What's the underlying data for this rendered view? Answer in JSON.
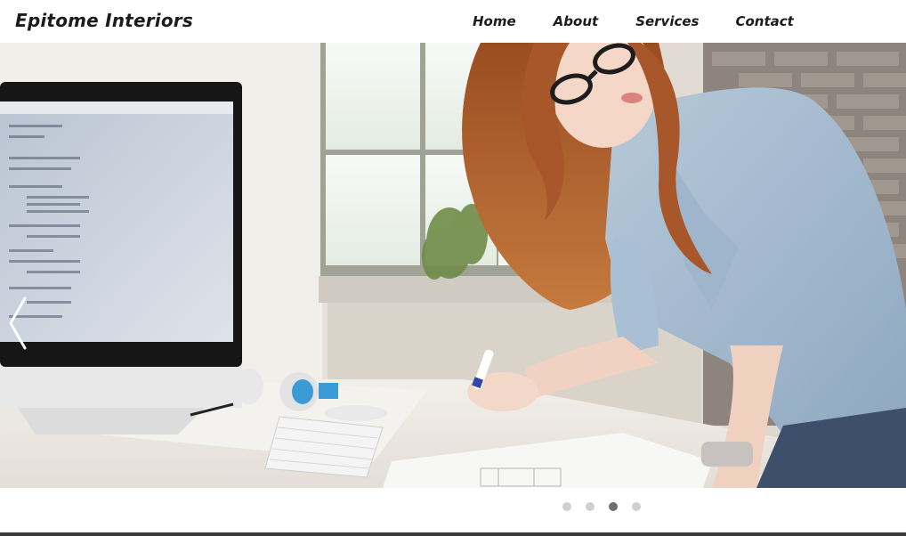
{
  "header": {
    "brand": "Epitome Interiors",
    "nav": [
      {
        "label": "Home"
      },
      {
        "label": "About"
      },
      {
        "label": "Services"
      },
      {
        "label": "Contact"
      }
    ]
  },
  "slider": {
    "slide_count": 4,
    "active_index": 2,
    "image": "woman-at-desk-photo",
    "prev_icon": "chevron-left-icon"
  }
}
